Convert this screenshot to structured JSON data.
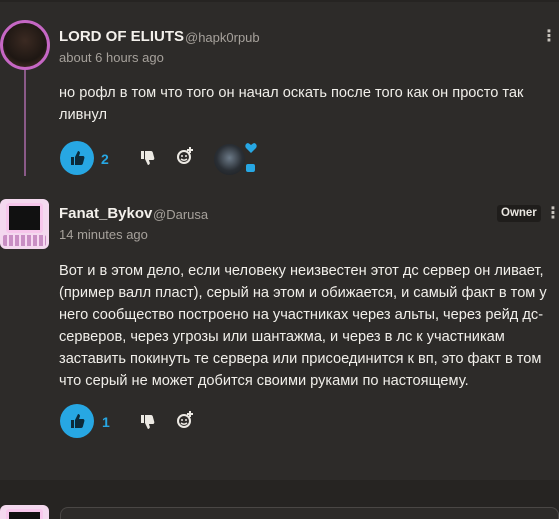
{
  "posts": [
    {
      "author": "LORD OF ELIUTS",
      "handle": "@hapk0rpub",
      "time": "about 6 hours ago",
      "body": "но рофл в том что того он начал оскать после того как он просто так ливнул",
      "likes": "2"
    },
    {
      "author": "Fanat_Bykov",
      "handle": "@Darusa",
      "badge": "Owner",
      "time": "14 minutes ago",
      "body": "Вот и в этом дело, если человеку неизвестен этот дс сервер он ливает, (пример валл пласт), серый на этом и обижается, и самый факт в том у него сообщество построено на участниках через альты, через рейд дс-серверов, через угрозы или шантажма, и через в лс к участникам заставить покинуть те сервера или присоединится к вп, это факт в том что серый не может добится своими руками по настоящему.",
      "likes": "1"
    }
  ],
  "icons": {
    "like": "thumbs-up-icon",
    "dislike": "thumbs-down-icon",
    "react": "add-reaction-icon",
    "more": "more-options-icon",
    "heart": "heart-icon"
  },
  "colors": {
    "background": "#2d2b29",
    "accent": "#27a7e3",
    "avatar_ring": "#c667c4"
  }
}
